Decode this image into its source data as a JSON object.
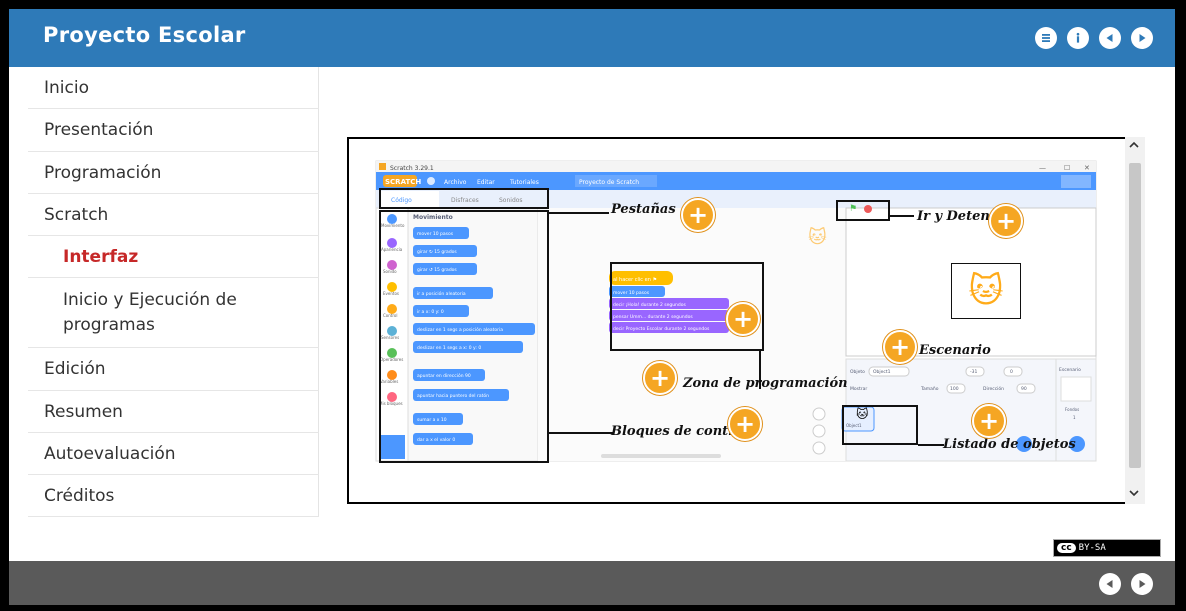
{
  "header": {
    "title": "Proyecto Escolar",
    "buttons": [
      {
        "name": "menu-icon",
        "glyph": "≡"
      },
      {
        "name": "info-icon",
        "glyph": "i"
      },
      {
        "name": "previous-icon",
        "glyph": "◀"
      },
      {
        "name": "next-icon",
        "glyph": "▶"
      }
    ]
  },
  "sidebar": {
    "items": [
      {
        "label": "Inicio"
      },
      {
        "label": "Presentación"
      },
      {
        "label": "Programación"
      },
      {
        "label": "Scratch"
      },
      {
        "label": "Interfaz"
      },
      {
        "label": "Inicio y Ejecución de programas"
      },
      {
        "label": "Edición"
      },
      {
        "label": "Resumen"
      },
      {
        "label": "Autoevaluación"
      },
      {
        "label": "Créditos"
      }
    ]
  },
  "figure": {
    "window_title": "Scratch 3.29.1",
    "menu": {
      "logo": "SCRATCH",
      "items": [
        "Archivo",
        "Editar",
        "Tutoriales"
      ],
      "project_name": "Proyecto de Scratch"
    },
    "tabs": [
      "Código",
      "Disfraces",
      "Sonidos"
    ],
    "categories": [
      "Movimiento",
      "Apariencia",
      "Sonido",
      "Eventos",
      "Control",
      "Sensores",
      "Operadores",
      "Variables",
      "Mis bloques"
    ],
    "palette_title": "Movimiento",
    "blocks": [
      "mover 10 pasos",
      "girar ↻ 15 grados",
      "girar ↺ 15 grados",
      "ir a posición aleatoria",
      "ir a x: 0 y: 0",
      "deslizar en 1 segs a posición aleatoria",
      "deslizar en 1 segs a x: 0 y: 0",
      "apuntar en dirección 90",
      "apuntar hacia puntero del ratón",
      "sumar a x 10",
      "dar a x el valor 0"
    ],
    "script": [
      "al hacer clic en ⚑",
      "mover 10 pasos",
      "decir ¡Hola! durante 2 segundos",
      "pensar Umm... durante 2 segundos",
      "decir Proyecto Escolar durante 2 segundos"
    ],
    "sprite_info": {
      "object_label": "Objeto",
      "object_name": "Object1",
      "x": "-31",
      "y": "0",
      "show_label": "Mostrar",
      "size_label": "Tamaño",
      "size": "100",
      "direction_label": "Dirección",
      "direction": "90",
      "stage_label": "Escenario",
      "backgrounds_label": "Fondos",
      "backgrounds_count": "1",
      "sprite_thumb_label": "Object1"
    },
    "annotations": {
      "tabs": "Pestañas",
      "go_stop": "Ir y Detener",
      "stage": "Escenario",
      "programming_zone": "Zona de programación",
      "control_blocks": "Bloques de control",
      "objects_list": "Listado de objetos"
    }
  },
  "footer": {
    "buttons": [
      {
        "name": "previous-icon",
        "glyph": "◀"
      },
      {
        "name": "next-icon",
        "glyph": "▶"
      }
    ]
  },
  "license": {
    "badge": "cc",
    "text": "BY-SA"
  },
  "colors": {
    "header": "#2e7ab8",
    "footer": "#5a5a5a",
    "active_item": "#c62828",
    "accent": "#f5a623",
    "scratch_blue": "#4c97ff",
    "scratch_purple": "#9966ff",
    "scratch_yellow": "#ffbf00"
  }
}
